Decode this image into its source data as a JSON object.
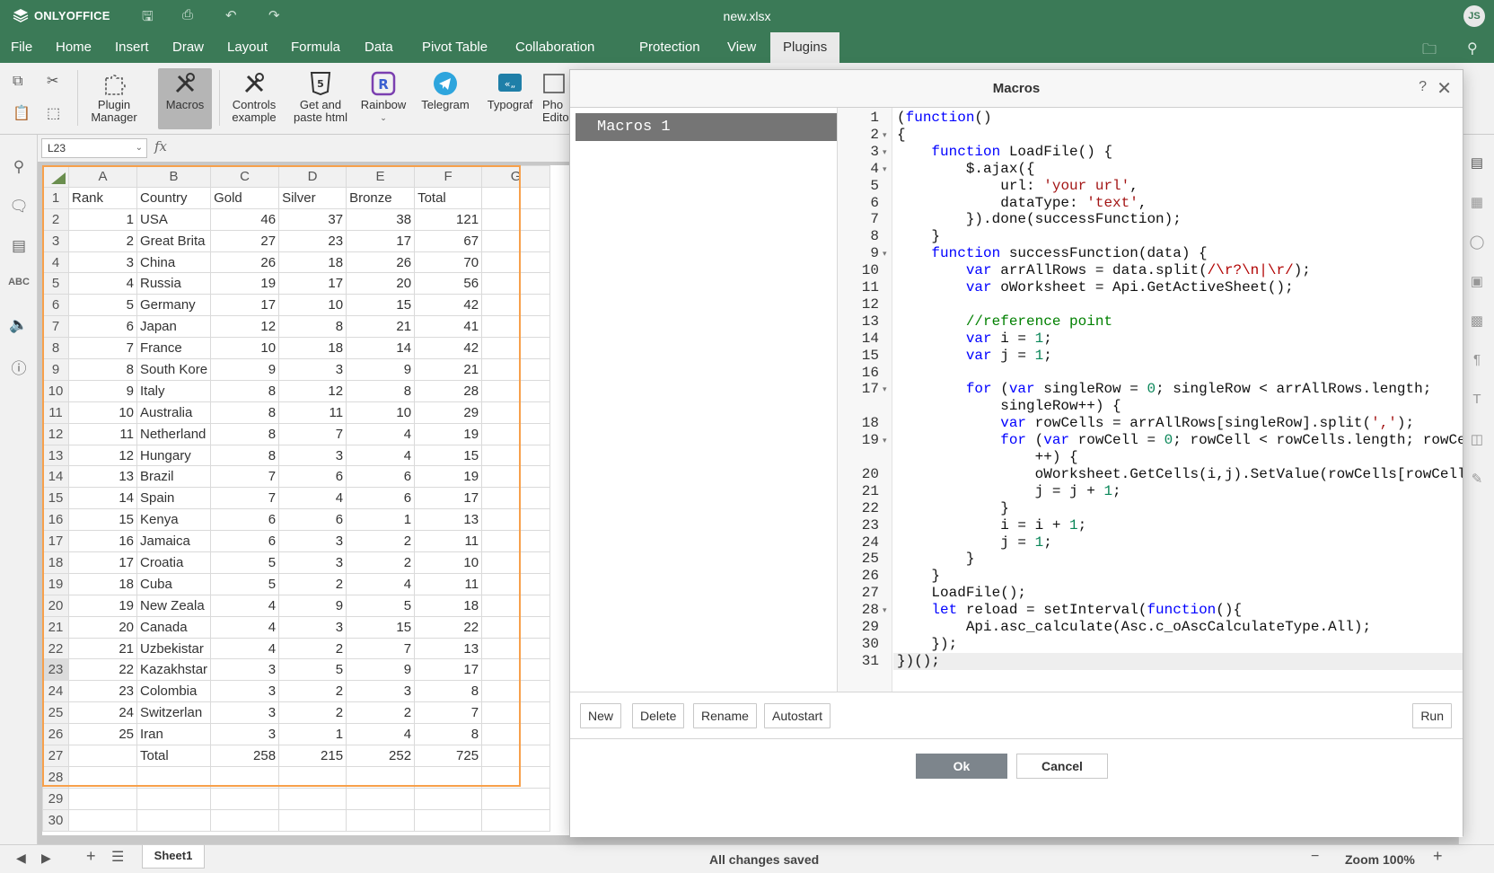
{
  "app": {
    "brand": "ONLYOFFICE",
    "doc_title": "new.xlsx",
    "user_initials": "JS"
  },
  "menu": [
    "File",
    "Home",
    "Insert",
    "Draw",
    "Layout",
    "Formula",
    "Data",
    "Pivot Table",
    "Collaboration",
    "Protection",
    "View",
    "Plugins"
  ],
  "active_menu": "Plugins",
  "toolbar": {
    "plugin_manager": "Plugin Manager",
    "macros": "Macros",
    "controls_example": "Controls example",
    "get_paste_html": "Get and paste html",
    "rainbow": "Rainbow",
    "telegram": "Telegram",
    "typograf": "Typograf",
    "photo_editor": "Pho Edito"
  },
  "formula_bar": {
    "cell_ref": "L23",
    "fx": "fx",
    "formula": ""
  },
  "sheet": {
    "col_headers": [
      "A",
      "B",
      "C",
      "D",
      "E",
      "F",
      "G"
    ],
    "selected_row": 23,
    "rows": [
      [
        "",
        "Rank",
        "Country",
        "Gold",
        "Silver",
        "Bronze",
        "Total"
      ],
      [
        "2",
        "1",
        "USA",
        "46",
        "37",
        "38",
        "121"
      ],
      [
        "3",
        "2",
        "Great Brita",
        "27",
        "23",
        "17",
        "67"
      ],
      [
        "4",
        "3",
        "China",
        "26",
        "18",
        "26",
        "70"
      ],
      [
        "5",
        "4",
        "Russia",
        "19",
        "17",
        "20",
        "56"
      ],
      [
        "6",
        "5",
        "Germany",
        "17",
        "10",
        "15",
        "42"
      ],
      [
        "7",
        "6",
        "Japan",
        "12",
        "8",
        "21",
        "41"
      ],
      [
        "8",
        "7",
        "France",
        "10",
        "18",
        "14",
        "42"
      ],
      [
        "9",
        "8",
        "South Kore",
        "9",
        "3",
        "9",
        "21"
      ],
      [
        "10",
        "9",
        "Italy",
        "8",
        "12",
        "8",
        "28"
      ],
      [
        "11",
        "10",
        "Australia",
        "8",
        "11",
        "10",
        "29"
      ],
      [
        "12",
        "11",
        "Netherland",
        "8",
        "7",
        "4",
        "19"
      ],
      [
        "13",
        "12",
        "Hungary",
        "8",
        "3",
        "4",
        "15"
      ],
      [
        "14",
        "13",
        "Brazil",
        "7",
        "6",
        "6",
        "19"
      ],
      [
        "15",
        "14",
        "Spain",
        "7",
        "4",
        "6",
        "17"
      ],
      [
        "16",
        "15",
        "Kenya",
        "6",
        "6",
        "1",
        "13"
      ],
      [
        "17",
        "16",
        "Jamaica",
        "6",
        "3",
        "2",
        "11"
      ],
      [
        "18",
        "17",
        "Croatia",
        "5",
        "3",
        "2",
        "10"
      ],
      [
        "19",
        "18",
        "Cuba",
        "5",
        "2",
        "4",
        "11"
      ],
      [
        "20",
        "19",
        "New Zeala",
        "4",
        "9",
        "5",
        "18"
      ],
      [
        "21",
        "20",
        "Canada",
        "4",
        "3",
        "15",
        "22"
      ],
      [
        "22",
        "21",
        "Uzbekistar",
        "4",
        "2",
        "7",
        "13"
      ],
      [
        "23",
        "22",
        "Kazakhstar",
        "3",
        "5",
        "9",
        "17"
      ],
      [
        "24",
        "23",
        "Colombia",
        "3",
        "2",
        "3",
        "8"
      ],
      [
        "25",
        "24",
        "Switzerlan",
        "3",
        "2",
        "2",
        "7"
      ],
      [
        "26",
        "25",
        "Iran",
        "3",
        "1",
        "4",
        "8"
      ],
      [
        "27",
        "",
        "Total",
        "258",
        "215",
        "252",
        "725"
      ],
      [
        "28",
        "",
        "",
        "",
        "",
        "",
        ""
      ],
      [
        "29",
        "",
        "",
        "",
        "",
        "",
        ""
      ],
      [
        "30",
        "",
        "",
        "",
        "",
        "",
        ""
      ]
    ]
  },
  "sheet_tabs": {
    "active": "Sheet1"
  },
  "status": {
    "text": "All changes saved",
    "zoom": "Zoom 100%"
  },
  "dialog": {
    "title": "Macros",
    "help": "?",
    "macros": [
      "Macros 1"
    ],
    "buttons": {
      "new": "New",
      "delete": "Delete",
      "rename": "Rename",
      "autostart": "Autostart",
      "run": "Run",
      "ok": "Ok",
      "cancel": "Cancel"
    },
    "code_lines": [
      "(function()",
      "{",
      "    function LoadFile() {",
      "        $.ajax({",
      "            url: 'your url',",
      "            dataType: 'text',",
      "        }).done(successFunction);",
      "    }",
      "    function successFunction(data) {",
      "        var arrAllRows = data.split(/\\r?\\n|\\r/);",
      "        var oWorksheet = Api.GetActiveSheet();",
      "",
      "        //reference point",
      "        var i = 1;",
      "        var j = 1;",
      "",
      "        for (var singleRow = 0; singleRow < arrAllRows.length;",
      "            singleRow++) {",
      "            var rowCells = arrAllRows[singleRow].split(',');",
      "            for (var rowCell = 0; rowCell < rowCells.length; rowCell",
      "                ++) {",
      "                oWorksheet.GetCells(i,j).SetValue(rowCells[rowCell]);",
      "                j = j + 1;",
      "            }",
      "            i = i + 1;",
      "            j = 1;",
      "        }",
      "    }",
      "    LoadFile();",
      "    let reload = setInterval(function(){",
      "        Api.asc_calculate(Asc.c_oAscCalculateType.All);",
      "    });",
      "})();"
    ],
    "line_numbers": [
      "1",
      "2",
      "3",
      "4",
      "5",
      "6",
      "7",
      "8",
      "9",
      "10",
      "11",
      "12",
      "13",
      "14",
      "15",
      "16",
      "17",
      "",
      "18",
      "19",
      "",
      "20",
      "21",
      "22",
      "23",
      "24",
      "25",
      "26",
      "27",
      "28",
      "29",
      "30",
      "31"
    ],
    "fold_lines": [
      "2",
      "3",
      "4",
      "9",
      "17",
      "19",
      "28"
    ]
  }
}
